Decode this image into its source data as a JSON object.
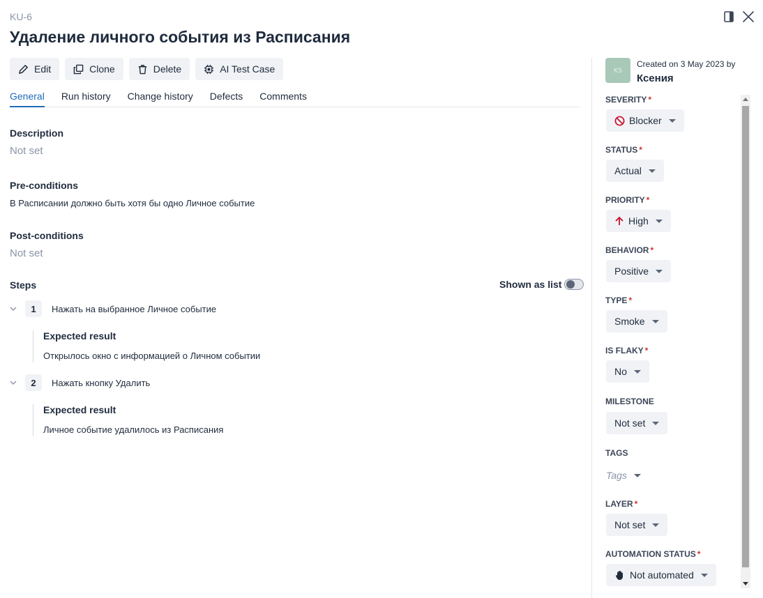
{
  "header": {
    "case_id": "KU-6",
    "title": "Удаление личного события из Расписания"
  },
  "toolbar": {
    "edit_label": "Edit",
    "clone_label": "Clone",
    "delete_label": "Delete",
    "ai_label": "AI Test Case"
  },
  "tabs": [
    {
      "label": "General",
      "active": true
    },
    {
      "label": "Run history",
      "active": false
    },
    {
      "label": "Change history",
      "active": false
    },
    {
      "label": "Defects",
      "active": false
    },
    {
      "label": "Comments",
      "active": false
    }
  ],
  "general": {
    "description_label": "Description",
    "description_value": "Not set",
    "preconditions_label": "Pre-conditions",
    "preconditions_value": "В Расписании должно быть хотя бы одно Личное событие",
    "postconditions_label": "Post-conditions",
    "postconditions_value": "Not set",
    "steps_label": "Steps",
    "shown_as_list_label": "Shown as list",
    "shown_as_list_on": false
  },
  "steps": [
    {
      "number": "1",
      "text": "Нажать на выбранное Личное событие",
      "expected_label": "Expected result",
      "expected_text": "Открылось окно с информацией о Личном событии"
    },
    {
      "number": "2",
      "text": "Нажать кнопку Удалить",
      "expected_label": "Expected result",
      "expected_text": "Личное событие удалилось из Расписания"
    }
  ],
  "sidebar": {
    "avatar_initials": "KS",
    "created_text": "Created on 3 May 2023 by",
    "author": "Ксения",
    "fields": {
      "severity": {
        "label": "SEVERITY",
        "value": "Blocker",
        "required": "*"
      },
      "status": {
        "label": "STATUS",
        "value": "Actual",
        "required": "*"
      },
      "priority": {
        "label": "PRIORITY",
        "value": "High",
        "required": "*"
      },
      "behavior": {
        "label": "BEHAVIOR",
        "value": "Positive",
        "required": "*"
      },
      "type": {
        "label": "TYPE",
        "value": "Smoke",
        "required": "*"
      },
      "is_flaky": {
        "label": "IS FLAKY",
        "value": "No",
        "required": "*"
      },
      "milestone": {
        "label": "MILESTONE",
        "value": "Not set"
      },
      "tags": {
        "label": "TAGS",
        "value": "Tags"
      },
      "layer": {
        "label": "LAYER",
        "value": "Not set",
        "required": "*"
      },
      "automation_status": {
        "label": "AUTOMATION STATUS",
        "value": "Not automated",
        "required": "*"
      }
    }
  },
  "colors": {
    "accent": "#1f6bb8",
    "required": "#d0312d",
    "blocker": "#c8102e",
    "priority_high": "#c8102e"
  }
}
